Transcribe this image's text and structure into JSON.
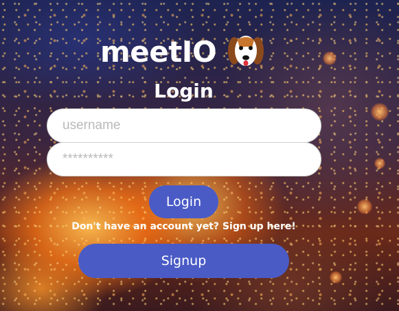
{
  "brand": {
    "name": "meetIO",
    "logo_icon": "dog-face-icon"
  },
  "title": "Login",
  "form": {
    "username_placeholder": "username",
    "password_placeholder": "**********",
    "login_label": "Login",
    "signup_hint": "Don't have an account yet? Sign up here!",
    "signup_label": "Signup"
  },
  "colors": {
    "button": "#4a5bc6",
    "text": "#ffffff",
    "field_bg": "#ffffff"
  }
}
